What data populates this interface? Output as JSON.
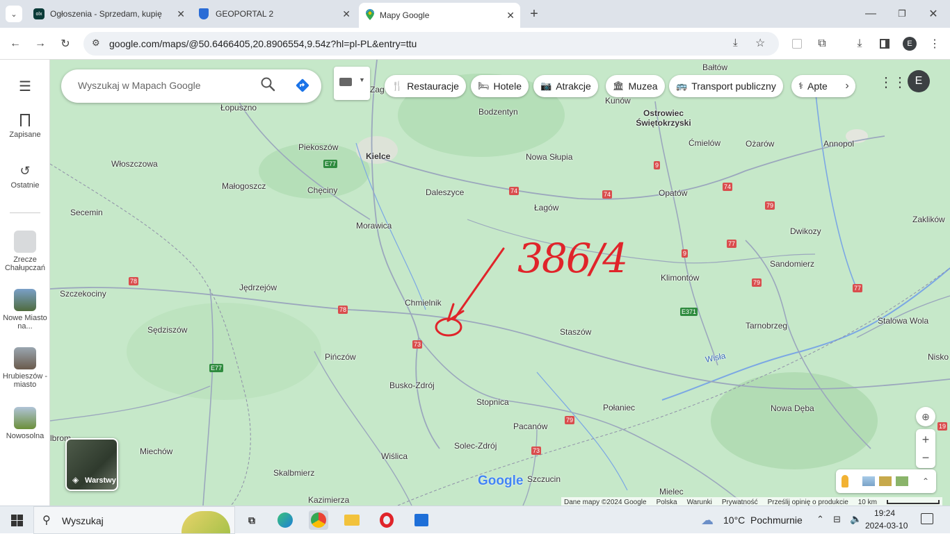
{
  "browser": {
    "tabs": [
      {
        "title": "Ogłoszenia - Sprzedam, kupię",
        "favicon": "olx"
      },
      {
        "title": "GEOPORTAL 2",
        "favicon": "shield"
      },
      {
        "title": "Mapy Google",
        "favicon": "maps-pin"
      }
    ],
    "url": "google.com/maps/@50.6466405,20.8906554,9.54z?hl=pl-PL&entry=ttu",
    "profile_initial": "E"
  },
  "rail": {
    "saved_label": "Zapisane",
    "recent_label": "Ostatnie",
    "places": [
      {
        "label": "Zrecze Chałupczań"
      },
      {
        "label": "Nowe Miasto na..."
      },
      {
        "label": "Hrubieszów - miasto"
      },
      {
        "label": "Nowosolna"
      }
    ]
  },
  "search": {
    "placeholder": "Wyszukaj w Mapach Google"
  },
  "chips": [
    {
      "label": "Restauracje",
      "icon": "fork-knife-icon"
    },
    {
      "label": "Hotele",
      "icon": "bed-icon"
    },
    {
      "label": "Atrakcje",
      "icon": "camera-icon"
    },
    {
      "label": "Muzea",
      "icon": "museum-icon"
    },
    {
      "label": "Transport publiczny",
      "icon": "bus-icon"
    },
    {
      "label": "Apte",
      "icon": "pharmacy-icon"
    }
  ],
  "map": {
    "annotation_text": "386/4",
    "layers_label": "Warstwy",
    "google_logo": "Google",
    "footer": [
      "Dane mapy ©2024 Google",
      "Polska",
      "Warunki",
      "Prywatność",
      "Prześlij opinię o produkcie"
    ],
    "scale_label": "10 km",
    "places": [
      {
        "name": "Bałtów"
      },
      {
        "name": "Zag"
      },
      {
        "name": "Kunów"
      },
      {
        "name": "Łopuszno"
      },
      {
        "name": "Bodzentyn"
      },
      {
        "name": "Ostrowiec Świętokrzyski"
      },
      {
        "name": "Piekoszów"
      },
      {
        "name": "Kielce"
      },
      {
        "name": "Nowa Słupia"
      },
      {
        "name": "Ćmielów"
      },
      {
        "name": "Ożarów"
      },
      {
        "name": "Annopol"
      },
      {
        "name": "Włoszczowa"
      },
      {
        "name": "Małogoszcz"
      },
      {
        "name": "Chęciny"
      },
      {
        "name": "Daleszyce"
      },
      {
        "name": "Łagów"
      },
      {
        "name": "Opatów"
      },
      {
        "name": "Secemin"
      },
      {
        "name": "Morawica"
      },
      {
        "name": "Dwikozy"
      },
      {
        "name": "Zaklików"
      },
      {
        "name": "Sandomierz"
      },
      {
        "name": "Szczekociny"
      },
      {
        "name": "Jędrzejów"
      },
      {
        "name": "Klimontów"
      },
      {
        "name": "Chmielnik"
      },
      {
        "name": "Tarnobrzeg"
      },
      {
        "name": "Stalowa Wola"
      },
      {
        "name": "Sędziszów"
      },
      {
        "name": "Staszów"
      },
      {
        "name": "Pińczów"
      },
      {
        "name": "Nisko"
      },
      {
        "name": "Wisła"
      },
      {
        "name": "Busko-Zdrój"
      },
      {
        "name": "Stopnica"
      },
      {
        "name": "Połaniec"
      },
      {
        "name": "Nowa Dęba"
      },
      {
        "name": "Pacanów"
      },
      {
        "name": "Miechów"
      },
      {
        "name": "Solec-Zdrój"
      },
      {
        "name": "Wiślica"
      },
      {
        "name": "Skalbmierz"
      },
      {
        "name": "Szczucin"
      },
      {
        "name": "Mielec"
      },
      {
        "name": "Kazimierza"
      },
      {
        "name": "lbrom"
      }
    ],
    "roads": [
      "E77",
      "74",
      "9",
      "74",
      "74",
      "79",
      "77",
      "78",
      "78",
      "9",
      "77",
      "79",
      "E371",
      "73",
      "E77",
      "77",
      "79",
      "73",
      "19"
    ]
  },
  "taskbar": {
    "search_label": "Wyszukaj",
    "weather": "10°C  Pochmurnie",
    "time": "19:24",
    "date": "2024-03-10"
  }
}
